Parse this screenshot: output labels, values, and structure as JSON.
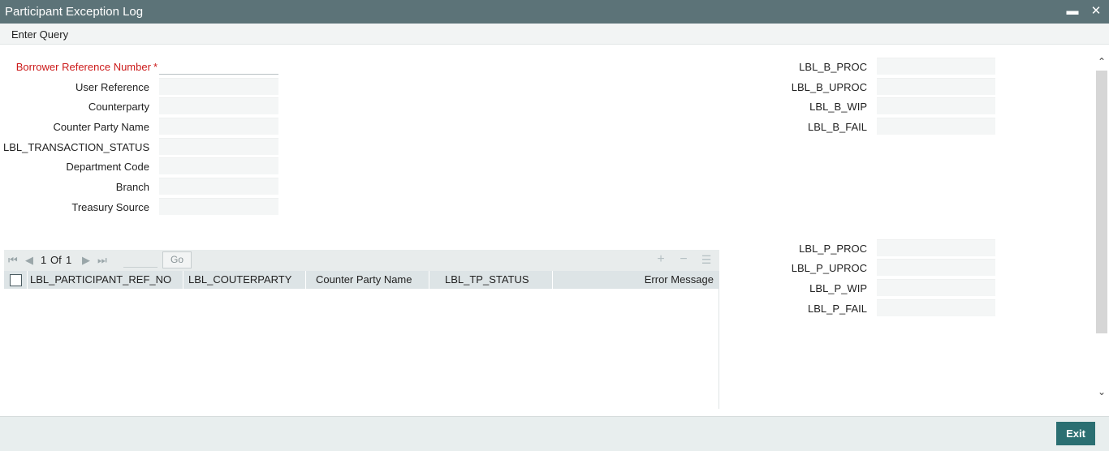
{
  "window": {
    "title": "Participant Exception Log",
    "minimize_icon": "minimize-icon",
    "close_icon": "close-icon"
  },
  "menu": {
    "enter_query": "Enter Query"
  },
  "form_left": {
    "borrower_ref": {
      "label": "Borrower Reference Number",
      "required_mark": "*",
      "value": ""
    },
    "user_reference": {
      "label": "User Reference",
      "value": ""
    },
    "counterparty": {
      "label": "Counterparty",
      "value": ""
    },
    "counter_party_name": {
      "label": "Counter Party Name",
      "value": ""
    },
    "transaction_status": {
      "label": "LBL_TRANSACTION_STATUS",
      "value": ""
    },
    "department_code": {
      "label": "Department Code",
      "value": ""
    },
    "branch": {
      "label": "Branch",
      "value": ""
    },
    "treasury_source": {
      "label": "Treasury Source",
      "value": ""
    }
  },
  "form_right_b": {
    "b_proc": {
      "label": "LBL_B_PROC",
      "value": ""
    },
    "b_uproc": {
      "label": "LBL_B_UPROC",
      "value": ""
    },
    "b_wip": {
      "label": "LBL_B_WIP",
      "value": ""
    },
    "b_fail": {
      "label": "LBL_B_FAIL",
      "value": ""
    }
  },
  "form_right_p": {
    "p_proc": {
      "label": "LBL_P_PROC",
      "value": ""
    },
    "p_uproc": {
      "label": "LBL_P_UPROC",
      "value": ""
    },
    "p_wip": {
      "label": "LBL_P_WIP",
      "value": ""
    },
    "p_fail": {
      "label": "LBL_P_FAIL",
      "value": ""
    }
  },
  "grid": {
    "pagination": {
      "current": "1",
      "of_label": "Of",
      "total": "1",
      "go_label": "Go"
    },
    "columns": [
      "LBL_PARTICIPANT_REF_NO",
      "LBL_COUTERPARTY",
      "Counter Party Name",
      "LBL_TP_STATUS",
      "Error Message"
    ],
    "rows": []
  },
  "footer": {
    "exit_label": "Exit"
  },
  "colors": {
    "titlebar": "#5c7378",
    "exit_button": "#2b6f72",
    "required_label": "#cc1a1a",
    "grid_header": "#dde4e6"
  }
}
